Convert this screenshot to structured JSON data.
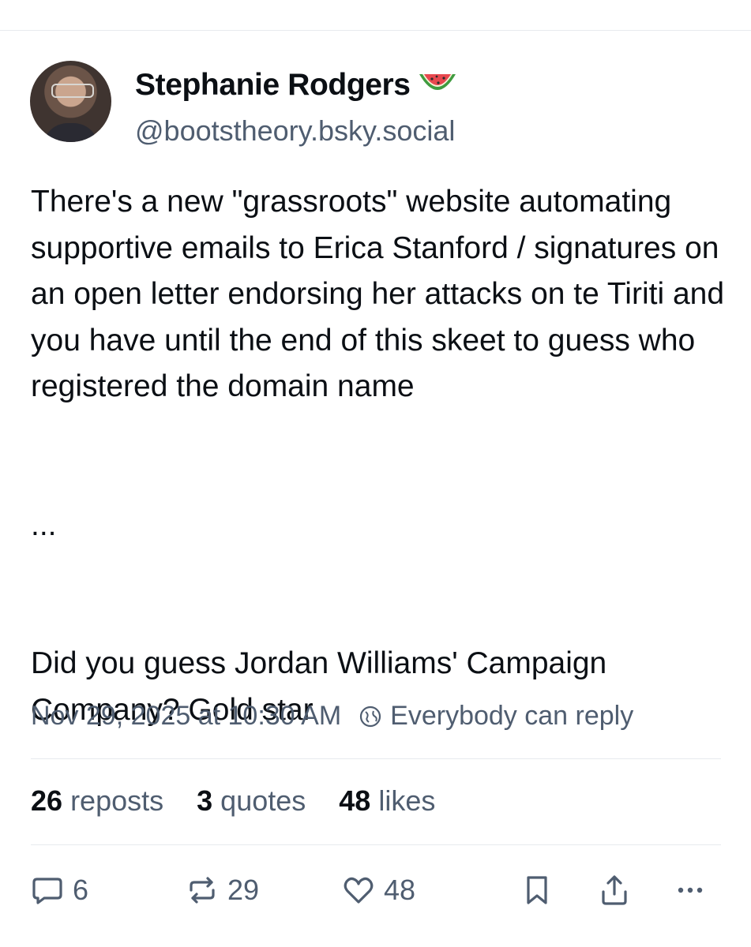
{
  "author": {
    "display_name": "Stephanie Rodgers",
    "handle": "@bootstheory.bsky.social"
  },
  "post": {
    "text": "There's a new \"grassroots\" website automating supportive emails to Erica Stanford / signatures on an open letter endorsing her attacks on te Tiriti and you have until the end of this skeet to guess who registered the domain name\n\n\n...\n\n\nDid you guess Jordan Williams' Campaign Company? Gold star",
    "timestamp": "Nov 29, 2025 at 10:30 AM",
    "reply_setting": "Everybody can reply"
  },
  "stats": {
    "reposts_count": "26",
    "reposts_label": "reposts",
    "quotes_count": "3",
    "quotes_label": "quotes",
    "likes_count": "48",
    "likes_label": "likes"
  },
  "actions": {
    "reply_count": "6",
    "repost_count": "29",
    "like_count": "48"
  },
  "colors": {
    "text": "#0b0f14",
    "secondary": "#4f5d70",
    "divider": "#e7eaee"
  }
}
